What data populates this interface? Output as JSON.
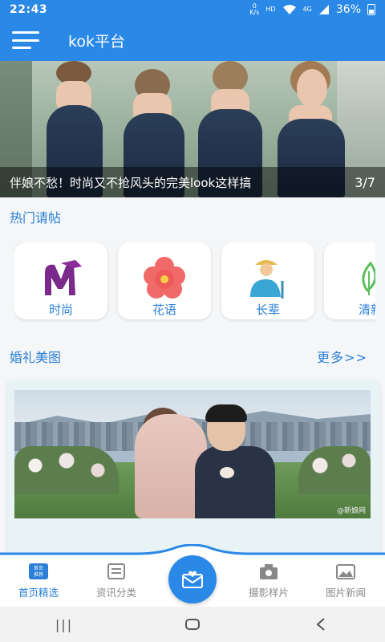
{
  "status_bar": {
    "time": "22:43",
    "net_speed_top": "K/s",
    "net_speed_bottom": "0",
    "hd": "HD",
    "signal": "4G",
    "battery": "36%"
  },
  "app_bar": {
    "title": "kok平台",
    "menu_icon": "menu-icon"
  },
  "banner": {
    "caption": "伴娘不愁！时尚又不抢风头的完美look这样搞",
    "pager": "3/7"
  },
  "hot_section": {
    "title": "热门请帖",
    "items": [
      {
        "label": "时尚",
        "icon": "fashion-icon"
      },
      {
        "label": "花语",
        "icon": "flower-icon"
      },
      {
        "label": "长辈",
        "icon": "elder-icon"
      },
      {
        "label": "清新",
        "icon": "leaf-icon"
      }
    ]
  },
  "wedding_section": {
    "title": "婚礼美图",
    "more": "更多>>",
    "watermark": "@新娘网"
  },
  "bottom_nav": {
    "items": [
      {
        "label": "首页精选",
        "icon_text": "首页推荐"
      },
      {
        "label": "资讯分类"
      },
      {
        "label": "摄影样片"
      },
      {
        "label": "图片新闻"
      }
    ],
    "center_icon": "invitation-icon"
  },
  "system_nav": {
    "recent": "|||",
    "home": "home-icon",
    "back": "back-icon"
  },
  "colors": {
    "primary": "#2a88e6",
    "text_accent": "#2a7fd6"
  }
}
